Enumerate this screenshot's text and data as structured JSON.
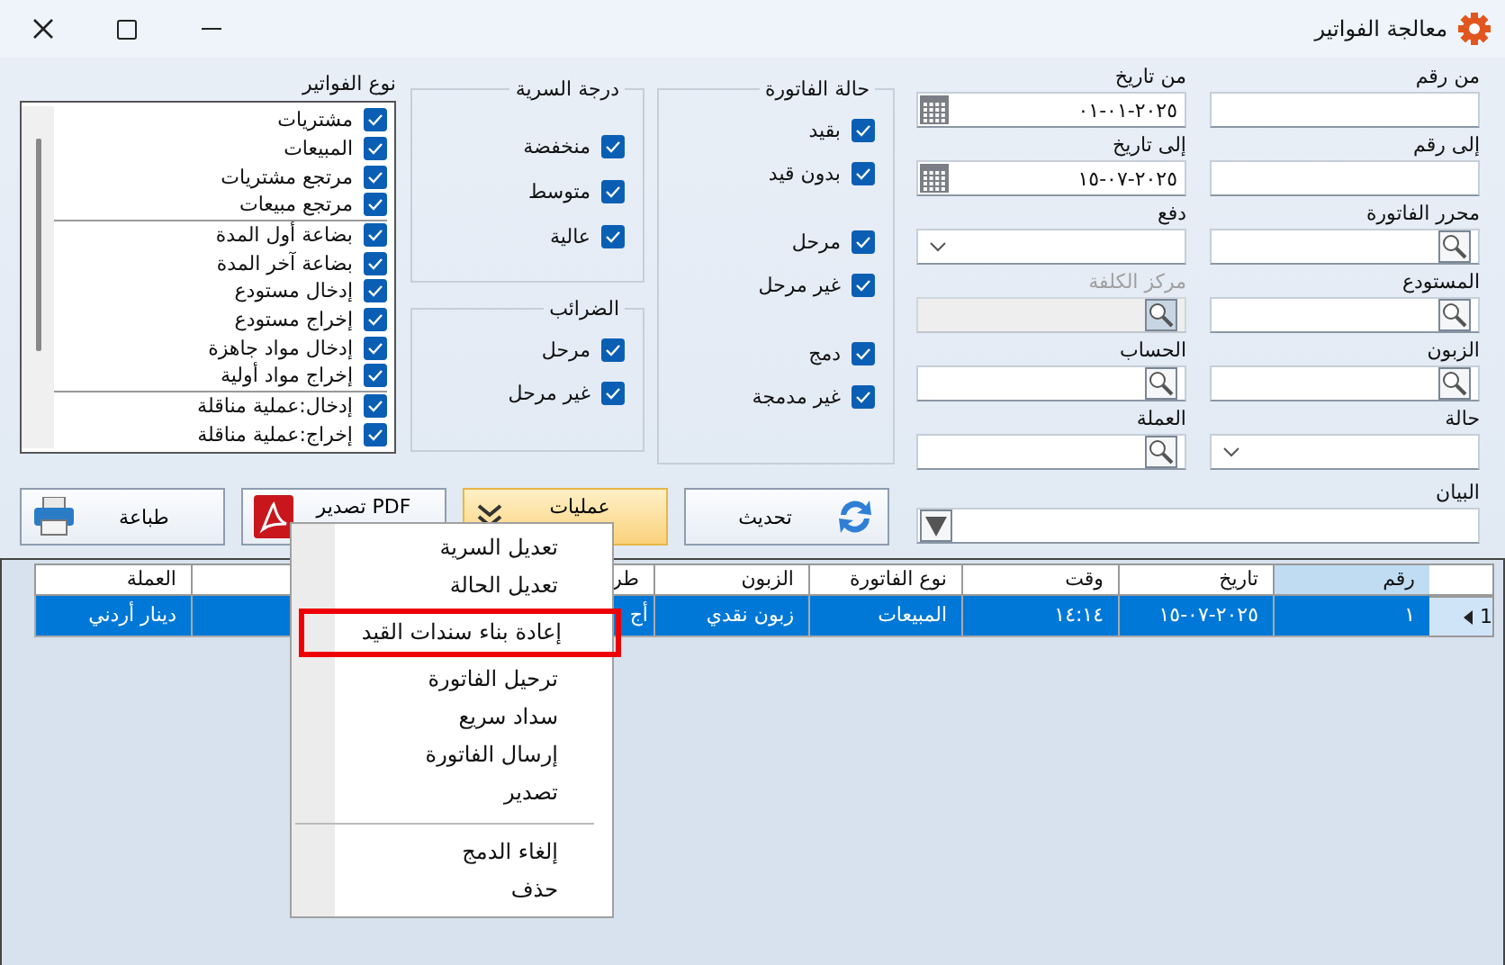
{
  "window": {
    "title": "معالجة الفواتير"
  },
  "fields_right": [
    {
      "label": "من رقم",
      "kind": "text"
    },
    {
      "label": "إلى رقم",
      "kind": "text"
    },
    {
      "label": "محرر الفاتورة",
      "kind": "search"
    },
    {
      "label": "المستودع",
      "kind": "search"
    },
    {
      "label": "الزبون",
      "kind": "search"
    },
    {
      "label": "حالة",
      "kind": "dropdown"
    }
  ],
  "fields_left": [
    {
      "label": "من تاريخ",
      "kind": "date",
      "value": "٢٠٢٥-٠١-٠١"
    },
    {
      "label": "إلى تاريخ",
      "kind": "date",
      "value": "٢٠٢٥-٠٧-١٥"
    },
    {
      "label": "دفع",
      "kind": "dropdown"
    },
    {
      "label": "مركز الكلفة",
      "kind": "search",
      "disabled": true
    },
    {
      "label": "الحساب",
      "kind": "search"
    },
    {
      "label": "العملة",
      "kind": "search"
    }
  ],
  "invoice_status": {
    "title": "حالة الفاتورة",
    "groups": [
      {
        "items": [
          {
            "label": "بقيد",
            "checked": true
          },
          {
            "label": "بدون قيد",
            "checked": true
          }
        ]
      },
      {
        "items": [
          {
            "label": "مرحل",
            "checked": true
          },
          {
            "label": "غير مرحل",
            "checked": true
          }
        ]
      },
      {
        "items": [
          {
            "label": "دمج",
            "checked": true
          },
          {
            "label": "غير مدمجة",
            "checked": true
          }
        ]
      }
    ]
  },
  "secrecy": {
    "title": "درجة السرية",
    "items": [
      {
        "label": "منخفضة",
        "checked": true
      },
      {
        "label": "متوسط",
        "checked": true
      },
      {
        "label": "عالية",
        "checked": true
      }
    ]
  },
  "taxes": {
    "title": "الضرائب",
    "items": [
      {
        "label": "مرحل",
        "checked": true
      },
      {
        "label": "غير مرحل",
        "checked": true
      }
    ]
  },
  "invoice_types": {
    "title": "نوع الفواتير",
    "groups": [
      {
        "items": [
          {
            "label": "مشتريات",
            "checked": true
          },
          {
            "label": "المبيعات",
            "checked": true
          },
          {
            "label": "مرتجع مشتريات",
            "checked": true
          },
          {
            "label": "مرتجع مبيعات",
            "checked": true
          }
        ]
      },
      {
        "items": [
          {
            "label": "بضاعة أول المدة",
            "checked": true
          },
          {
            "label": "بضاعة آخر المدة",
            "checked": true
          },
          {
            "label": "إدخال مستودع",
            "checked": true
          },
          {
            "label": "إخراج مستودع",
            "checked": true
          },
          {
            "label": "إدخال مواد جاهزة",
            "checked": true
          },
          {
            "label": "إخراج مواد أولية",
            "checked": true
          }
        ]
      },
      {
        "items": [
          {
            "label": "إدخال:عملية مناقلة",
            "checked": true
          },
          {
            "label": "إخراج:عملية مناقلة",
            "checked": true
          }
        ]
      }
    ]
  },
  "statement": {
    "label": "البيان"
  },
  "buttons": [
    {
      "label": "تحديث",
      "kind": "refresh",
      "active": false
    },
    {
      "label": "عمليات",
      "kind": "menu",
      "active": true
    },
    {
      "label": "PDF تصدير",
      "kind": "pdf",
      "active": false
    },
    {
      "label": "طباعة",
      "kind": "print",
      "active": false
    }
  ],
  "grid": {
    "columns": [
      {
        "label": "رقم",
        "selected": true
      },
      {
        "label": "تاريخ",
        "selected": false
      },
      {
        "label": "وقت",
        "selected": false
      },
      {
        "label": "نوع الفاتورة",
        "selected": false
      },
      {
        "label": "الزبون",
        "selected": false
      },
      {
        "label": "طر",
        "selected": false
      },
      {
        "selected": false
      },
      {
        "label": "العملة",
        "selected": false
      }
    ],
    "rows": [
      {
        "row_header": "1",
        "selected": true,
        "cells": [
          "١",
          "٢٠٢٥-٠٧-١٥",
          "١٤:١٤",
          "المبيعات",
          "زبون نقدي",
          "أج",
          null,
          "دينار أردني"
        ]
      }
    ]
  },
  "context_menu": {
    "items": [
      {
        "kind": "item",
        "label": "تعديل السرية",
        "highlighted": false
      },
      {
        "kind": "item",
        "label": "تعديل الحالة",
        "highlighted": false
      },
      {
        "kind": "item",
        "label": "إعادة بناء سندات القيد",
        "highlighted": true
      },
      {
        "kind": "item",
        "label": "ترحيل الفاتورة",
        "highlighted": false
      },
      {
        "kind": "item",
        "label": "سداد سريع",
        "highlighted": false
      },
      {
        "kind": "item",
        "label": "إرسال الفاتورة",
        "highlighted": false
      },
      {
        "kind": "item",
        "label": "تصدير",
        "highlighted": false
      },
      {
        "kind": "separator"
      },
      {
        "kind": "item",
        "label": "إلغاء الدمج",
        "highlighted": false
      },
      {
        "kind": "item",
        "label": "حذف",
        "highlighted": false
      }
    ]
  }
}
